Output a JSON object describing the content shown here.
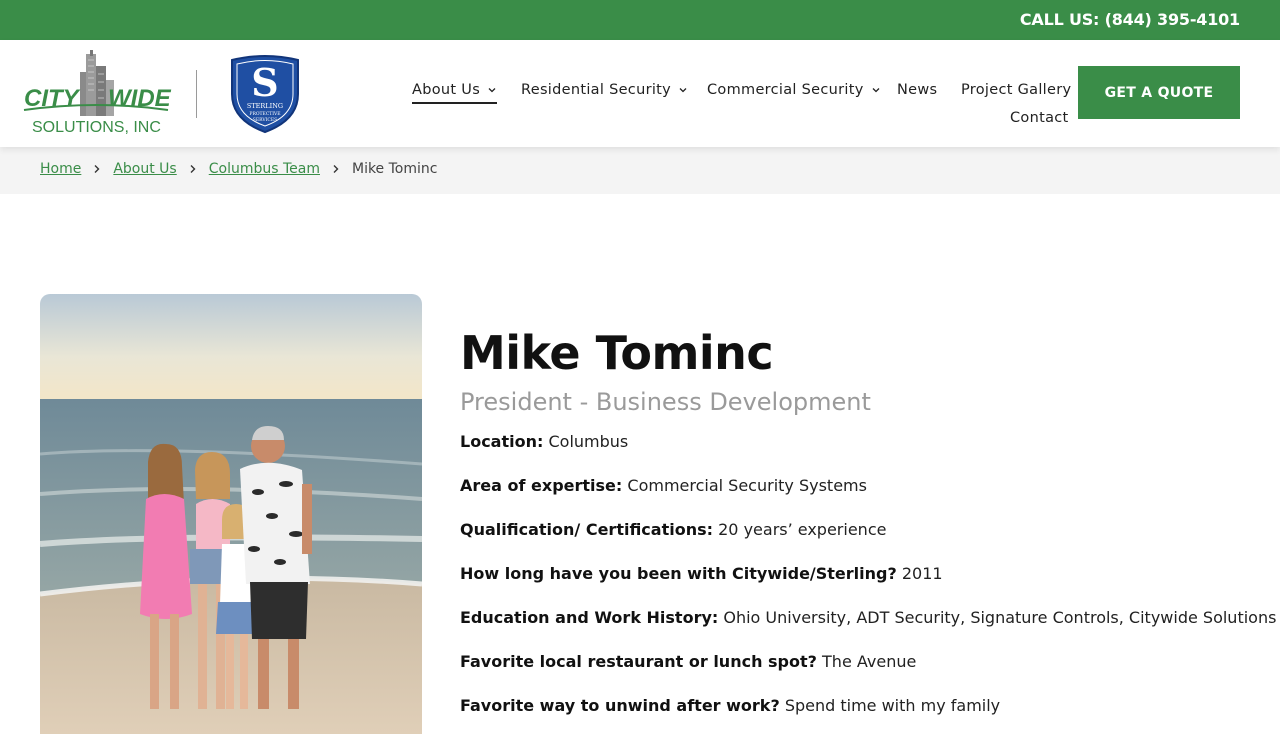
{
  "topbar": {
    "call_text": "CALL US: (844) 395-4101"
  },
  "logos": {
    "citywide_top": "CITY",
    "citywide_wide": "WIDE",
    "citywide_bottom": "SOLUTIONS, INC",
    "sterling_letter": "S",
    "sterling_name": "STERLING",
    "sterling_sub1": "PROTECTIVE",
    "sterling_sub2": "SERVICES"
  },
  "nav": {
    "items": [
      {
        "label": "About Us",
        "has_dropdown": true,
        "active": true
      },
      {
        "label": "Residential Security",
        "has_dropdown": true
      },
      {
        "label": "Commercial Security",
        "has_dropdown": true
      },
      {
        "label": "News",
        "has_dropdown": false
      },
      {
        "label": "Project Gallery",
        "has_dropdown": false
      },
      {
        "label": "Contact",
        "has_dropdown": false
      }
    ],
    "cta": "GET A QUOTE"
  },
  "breadcrumb": {
    "items": [
      "Home",
      "About Us",
      "Columbus Team"
    ],
    "current": "Mike Tominc"
  },
  "profile": {
    "name": "Mike Tominc",
    "title": "President - Business Development",
    "facts": [
      {
        "label": "Location:",
        "value": "Columbus"
      },
      {
        "label": "Area of expertise:",
        "value": "Commercial Security Systems"
      },
      {
        "label": "Qualification/ Certifications:",
        "value": "20 years’ experience"
      },
      {
        "label": "How long have you been with Citywide/Sterling?",
        "value": "2011"
      },
      {
        "label": "Education and Work History:",
        "value": "Ohio University, ADT Security, Signature Controls, Citywide Solutions"
      },
      {
        "label": "Favorite local restaurant or lunch spot?",
        "value": "The Avenue"
      },
      {
        "label": "Favorite way to unwind after work?",
        "value": "Spend time with my family"
      }
    ]
  },
  "colors": {
    "brand_green": "#3a8d48",
    "sterling_blue": "#1f4fa3",
    "title_gray": "#9a9a9a"
  }
}
